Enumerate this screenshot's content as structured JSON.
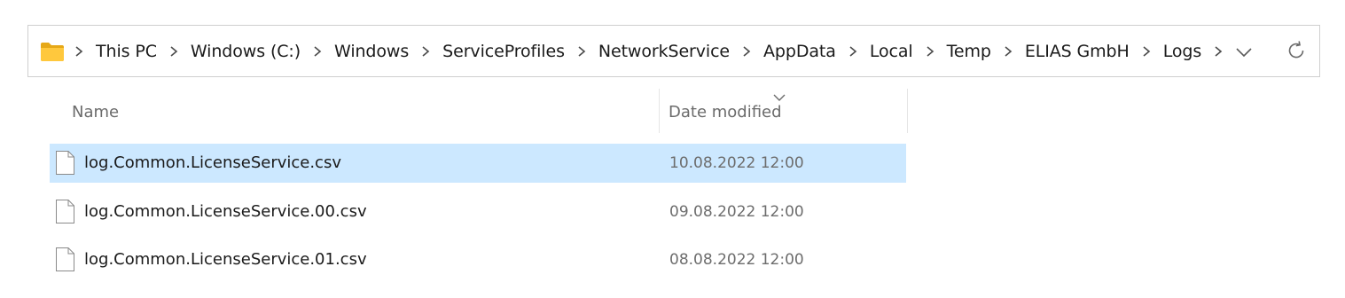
{
  "address_bar": {
    "breadcrumb": [
      "This PC",
      "Windows (C:)",
      "Windows",
      "ServiceProfiles",
      "NetworkService",
      "AppData",
      "Local",
      "Temp",
      "ELIAS GmbH",
      "Logs"
    ],
    "folder_icon": "folder-icon",
    "dropdown_icon": "chevron-down-icon",
    "refresh_icon": "refresh-icon"
  },
  "columns": {
    "name": "Name",
    "date_modified": "Date modified",
    "sort_indicator": "chevron-down-icon"
  },
  "files": [
    {
      "name": "log.Common.LicenseService.csv",
      "date": "10.08.2022  12:00",
      "selected": true,
      "icon": "file-icon"
    },
    {
      "name": "log.Common.LicenseService.00.csv",
      "date": "09.08.2022  12:00",
      "selected": false,
      "icon": "file-icon"
    },
    {
      "name": "log.Common.LicenseService.01.csv",
      "date": "08.08.2022  12:00",
      "selected": false,
      "icon": "file-icon"
    }
  ],
  "colors": {
    "selection": "#cce8ff",
    "folder": "#ffc83d",
    "border": "#cfcfcf",
    "muted_text": "#6d6d6d"
  }
}
